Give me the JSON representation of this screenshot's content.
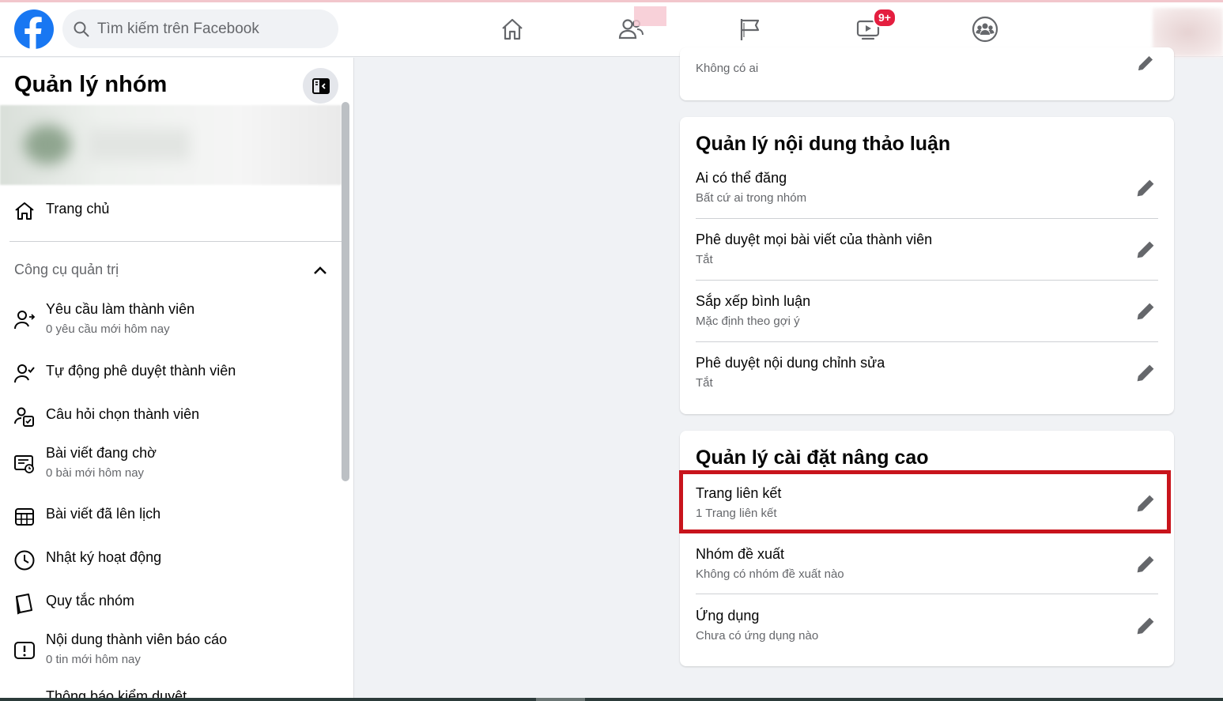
{
  "header": {
    "search_placeholder": "Tìm kiếm trên Facebook",
    "watch_badge": "9+"
  },
  "sidebar": {
    "title": "Quản lý nhóm",
    "home_label": "Trang chủ",
    "section_title": "Công cụ quản trị",
    "items": [
      {
        "label": "Yêu cầu làm thành viên",
        "sub": "0 yêu cầu mới hôm nay"
      },
      {
        "label": "Tự động phê duyệt thành viên",
        "sub": ""
      },
      {
        "label": "Câu hỏi chọn thành viên",
        "sub": ""
      },
      {
        "label": "Bài viết đang chờ",
        "sub": "0 bài mới hôm nay"
      },
      {
        "label": "Bài viết đã lên lịch",
        "sub": ""
      },
      {
        "label": "Nhật ký hoạt động",
        "sub": ""
      },
      {
        "label": "Quy tắc nhóm",
        "sub": ""
      },
      {
        "label": "Nội dung thành viên báo cáo",
        "sub": "0 tin mới hôm nay"
      },
      {
        "label": "Thông báo kiểm duyệt",
        "sub": ""
      }
    ]
  },
  "main": {
    "top_card_sub": "Không có ai",
    "discussion": {
      "title": "Quản lý nội dung thảo luận",
      "rows": [
        {
          "label": "Ai có thể đăng",
          "sub": "Bất cứ ai trong nhóm"
        },
        {
          "label": "Phê duyệt mọi bài viết của thành viên",
          "sub": "Tắt"
        },
        {
          "label": "Sắp xếp bình luận",
          "sub": "Mặc định theo gợi ý"
        },
        {
          "label": "Phê duyệt nội dung chỉnh sửa",
          "sub": "Tắt"
        }
      ]
    },
    "advanced": {
      "title": "Quản lý cài đặt nâng cao",
      "rows": [
        {
          "label": "Trang liên kết",
          "sub": "1 Trang liên kết"
        },
        {
          "label": "Nhóm đề xuất",
          "sub": "Không có nhóm đề xuất nào"
        },
        {
          "label": "Ứng dụng",
          "sub": "Chưa có ứng dụng nào"
        }
      ]
    }
  },
  "colors": {
    "brand": "#1877f2",
    "badge": "#e41e3f",
    "highlight": "#c8141c"
  }
}
